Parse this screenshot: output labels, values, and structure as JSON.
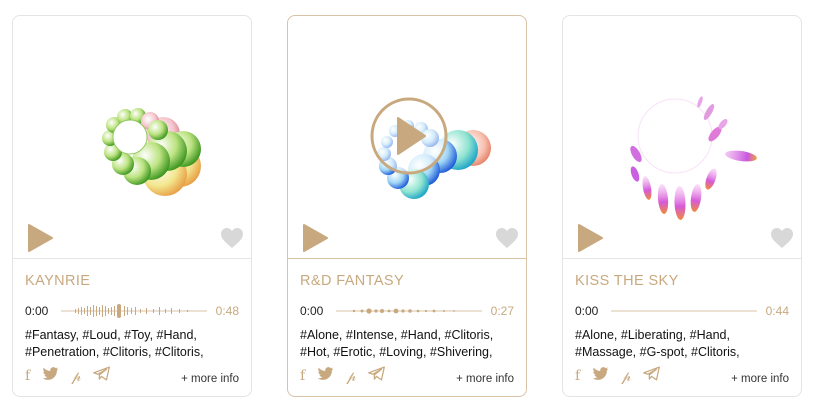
{
  "colors": {
    "accent": "#c8a97f",
    "heart": "#d8d8d8"
  },
  "cards": [
    {
      "title": "KAYNRIE",
      "time_start": "0:00",
      "time_end": "0:48",
      "tags_line1": "#Fantasy, #Loud, #Toy, #Hand,",
      "tags_line2": "#Penetration, #Clitoris, #Clitoris,",
      "more_label": "+ more info",
      "favorite": false,
      "visual": "green bubble ring"
    },
    {
      "title": "R&D FANTASY",
      "time_start": "0:00",
      "time_end": "0:27",
      "tags_line1": "#Alone, #Intense, #Hand, #Clitoris,",
      "tags_line2": "#Hot, #Erotic, #Loving, #Shivering,",
      "more_label": "+ more info",
      "favorite": false,
      "visual": "blue bubble ring"
    },
    {
      "title": "KISS THE SKY",
      "time_start": "0:00",
      "time_end": "0:44",
      "tags_line1": "#Alone, #Liberating, #Hand,",
      "tags_line2": "#Massage, #G-spot, #Clitoris,",
      "more_label": "+ more info",
      "favorite": false,
      "visual": "purple flame ring"
    }
  ],
  "share_icons": [
    "facebook-icon",
    "twitter-icon",
    "pinterest-icon",
    "telegram-icon"
  ],
  "share_glyphs": {
    "facebook": "f",
    "pinterest": "𝓅"
  }
}
